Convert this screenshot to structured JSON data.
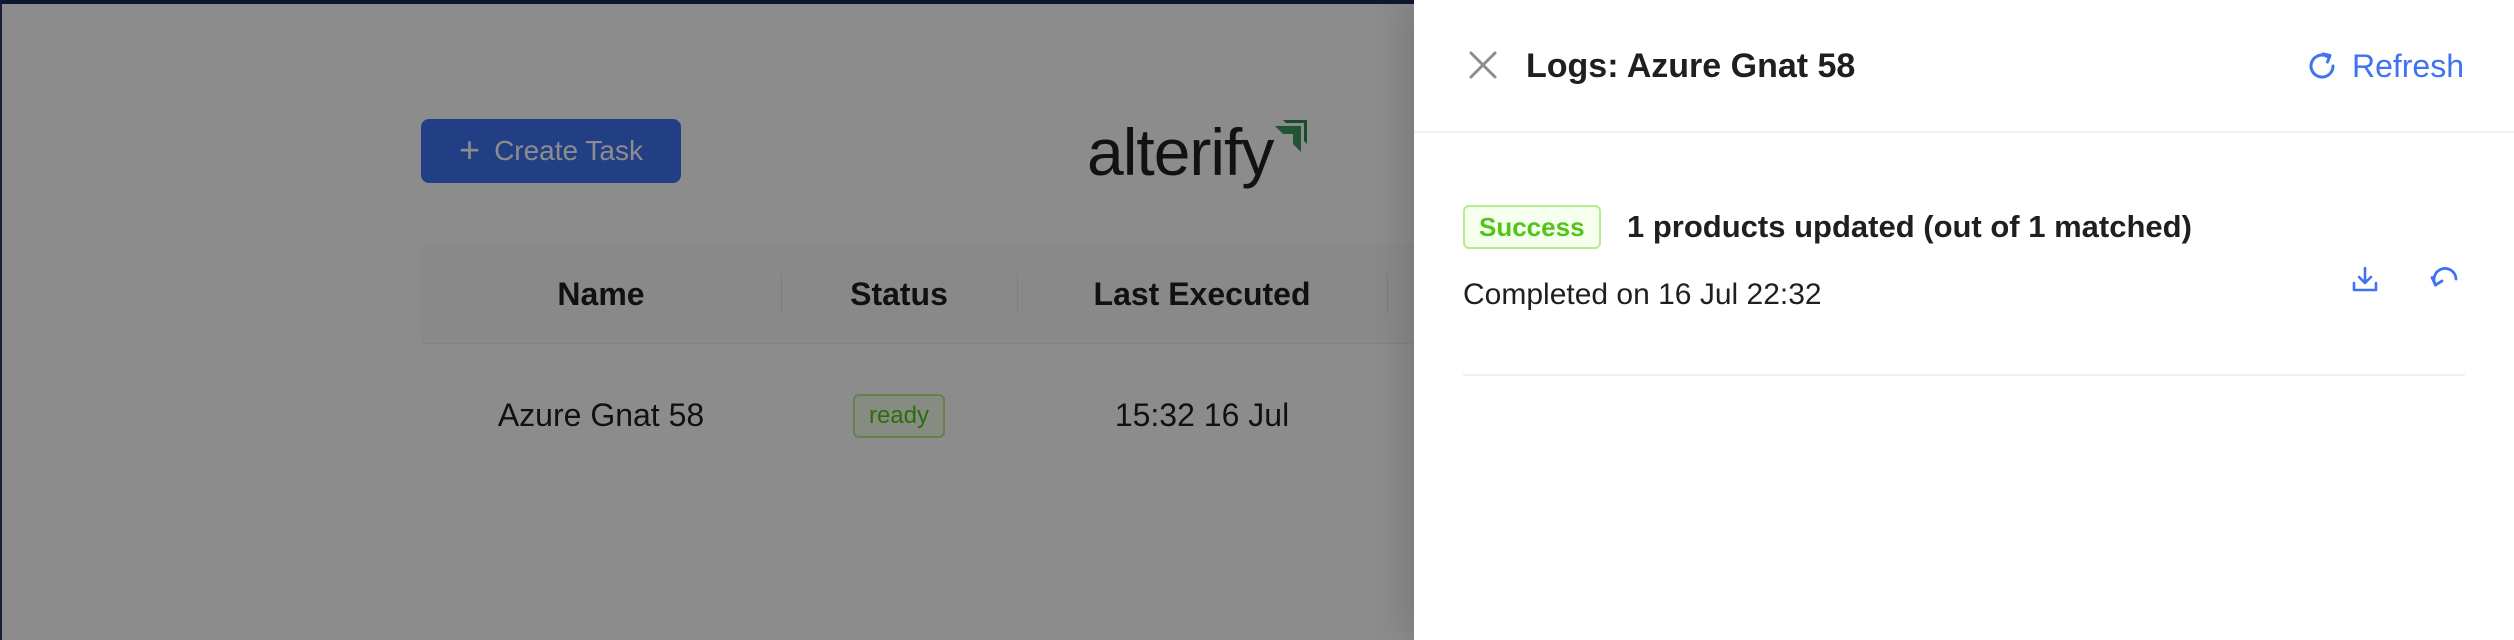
{
  "background": {
    "create_task_label": "Create Task",
    "logo_text": "alterify",
    "table": {
      "columns": [
        "Name",
        "Status",
        "Last Executed"
      ],
      "rows": [
        {
          "name": "Azure Gnat 58",
          "status": "ready",
          "last_executed": "15:32 16 Jul"
        }
      ]
    }
  },
  "drawer": {
    "title": "Logs: Azure Gnat 58",
    "refresh_label": "Refresh",
    "logs": [
      {
        "status": "Success",
        "summary": "1 products updated (out of 1 matched)",
        "completed": "Completed on 16 Jul 22:32",
        "actions": [
          "download-icon",
          "undo-icon"
        ]
      }
    ]
  },
  "colors": {
    "primary": "#3f73f2",
    "success_text": "#52c41a",
    "success_bg": "#f6ffed",
    "success_border": "#b7eb8f",
    "logo_accent": "#2e8b57"
  }
}
